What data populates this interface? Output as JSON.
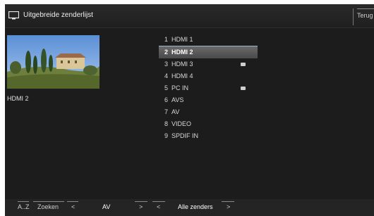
{
  "header": {
    "title": "Uitgebreide zenderlijst",
    "back_label": "Terug"
  },
  "preview": {
    "label": "HDMI 2"
  },
  "channels": [
    {
      "num": "1",
      "name": "HDMI 1",
      "selected": false,
      "badge": false
    },
    {
      "num": "2",
      "name": "HDMI 2",
      "selected": true,
      "badge": false
    },
    {
      "num": "3",
      "name": "HDMI 3",
      "selected": false,
      "badge": true
    },
    {
      "num": "4",
      "name": "HDMI 4",
      "selected": false,
      "badge": false
    },
    {
      "num": "5",
      "name": "PC IN",
      "selected": false,
      "badge": true
    },
    {
      "num": "6",
      "name": "AVS",
      "selected": false,
      "badge": false
    },
    {
      "num": "7",
      "name": "AV",
      "selected": false,
      "badge": false
    },
    {
      "num": "8",
      "name": "VIDEO",
      "selected": false,
      "badge": false
    },
    {
      "num": "9",
      "name": "SPDIF IN",
      "selected": false,
      "badge": false
    }
  ],
  "footer": {
    "az": "A..Z",
    "search": "Zoeken",
    "prev1": "<",
    "mode": "AV",
    "next1": ">",
    "prev2": "<",
    "filter": "Alle zenders",
    "next2": ">"
  }
}
